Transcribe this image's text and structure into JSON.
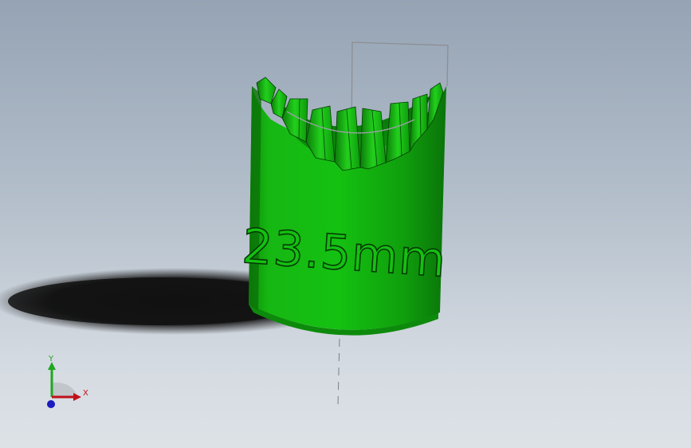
{
  "model": {
    "embossed_text": "23.5mm",
    "body_color": "#13c00f",
    "body_shadow_color": "#0a7d09",
    "body_highlight_color": "#2edc26"
  },
  "triad": {
    "x_label": "X",
    "y_label": "Y",
    "x_color": "#c0101a",
    "y_color": "#1fa81f",
    "z_color": "#1a1ac0"
  },
  "background": {
    "top_color": "#95a3b4",
    "bottom_color": "#dde2e7"
  }
}
